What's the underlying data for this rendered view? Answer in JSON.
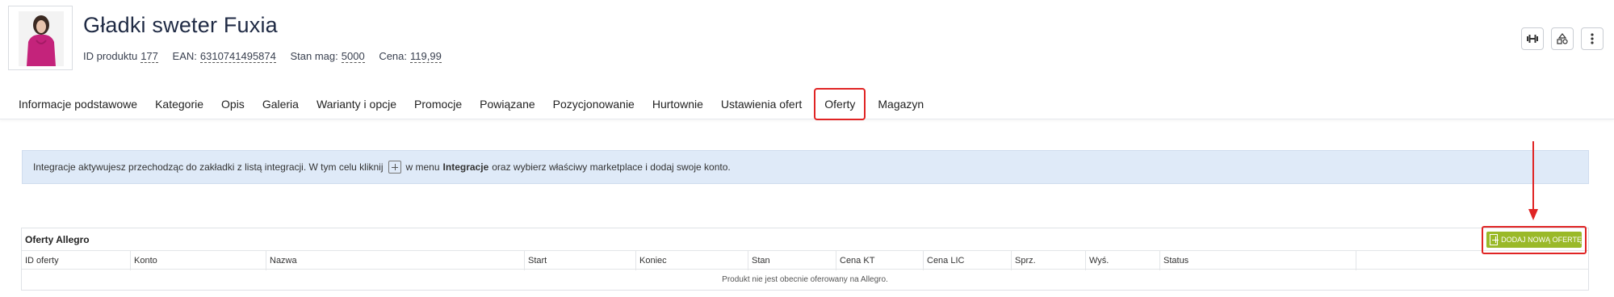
{
  "product": {
    "title": "Gładki sweter Fuxia",
    "id_label": "ID produktu",
    "id_value": "177",
    "ean_label": "EAN:",
    "ean_value": "6310741495874",
    "stock_label": "Stan mag:",
    "stock_value": "5000",
    "price_label": "Cena:",
    "price_value": "119,99"
  },
  "header_buttons": [
    "dumbbell-icon",
    "shapes-icon",
    "kebab-menu-icon"
  ],
  "tabs": [
    "Informacje podstawowe",
    "Kategorie",
    "Opis",
    "Galeria",
    "Warianty i opcje",
    "Promocje",
    "Powiązane",
    "Pozycjonowanie",
    "Hurtownie",
    "Ustawienia ofert",
    "Oferty",
    "Magazyn"
  ],
  "active_tab": "Oferty",
  "info": {
    "part1": "Integracje aktywujesz przechodząc do zakładki z listą integracji. W tym celu kliknij",
    "part2": "w menu",
    "bold": "Integracje",
    "part3": "oraz wybierz właściwy marketplace i dodaj swoje konto."
  },
  "offers": {
    "title": "Oferty Allegro",
    "add_button": "DODAJ NOWĄ OFERTĘ",
    "columns": [
      "ID oferty",
      "Konto",
      "Nazwa",
      "Start",
      "Koniec",
      "Stan",
      "Cena KT",
      "Cena LIC",
      "Sprz.",
      "Wyś.",
      "Status",
      ""
    ],
    "empty_message": "Produkt nie jest obecnie oferowany na Allegro."
  },
  "colors": {
    "accent_red": "#e02424",
    "add_green": "#9ab928",
    "info_bg": "#dfeaf8"
  }
}
